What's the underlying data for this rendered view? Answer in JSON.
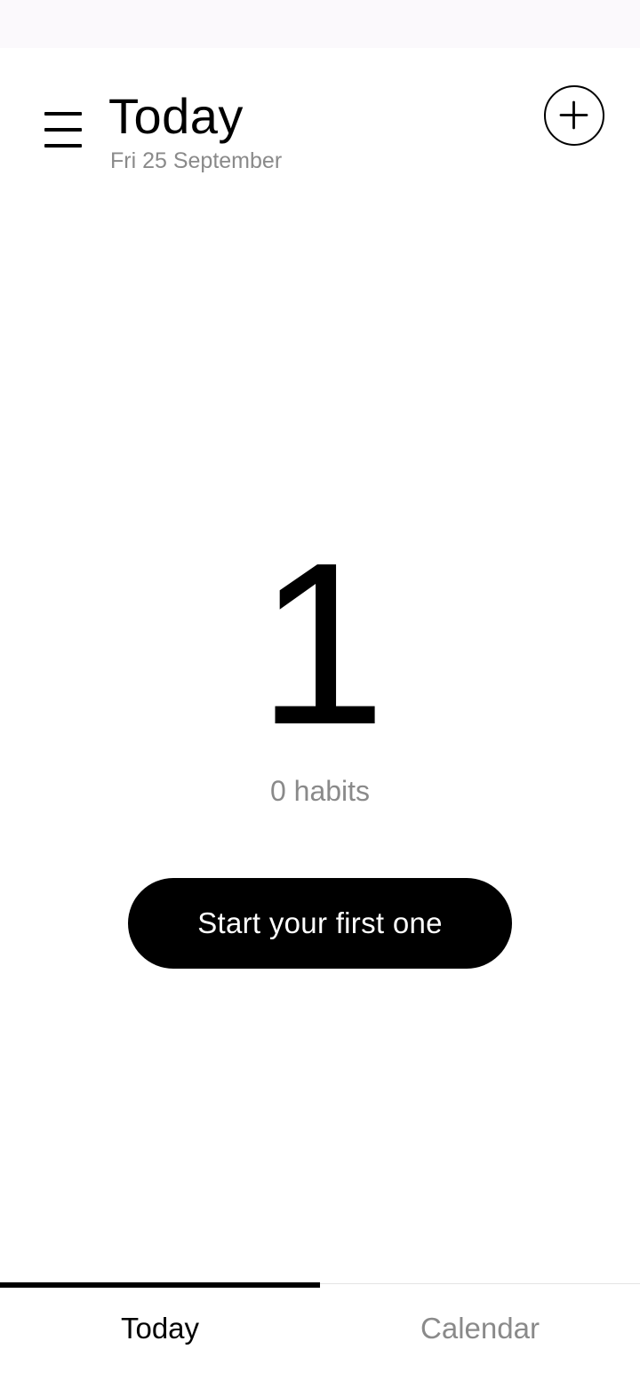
{
  "header": {
    "title": "Today",
    "date": "Fri 25 September",
    "menu_icon": "hamburger-menu-icon",
    "add_icon": "plus-circle-icon"
  },
  "main": {
    "big_number": "1",
    "habit_count": "0 habits",
    "start_button_label": "Start your first one"
  },
  "tabs": [
    {
      "label": "Today",
      "active": true
    },
    {
      "label": "Calendar",
      "active": false
    }
  ],
  "colors": {
    "primary": "#000000",
    "secondary_text": "#8a8a8a",
    "background": "#ffffff",
    "status_bar": "#fbf9fc"
  }
}
